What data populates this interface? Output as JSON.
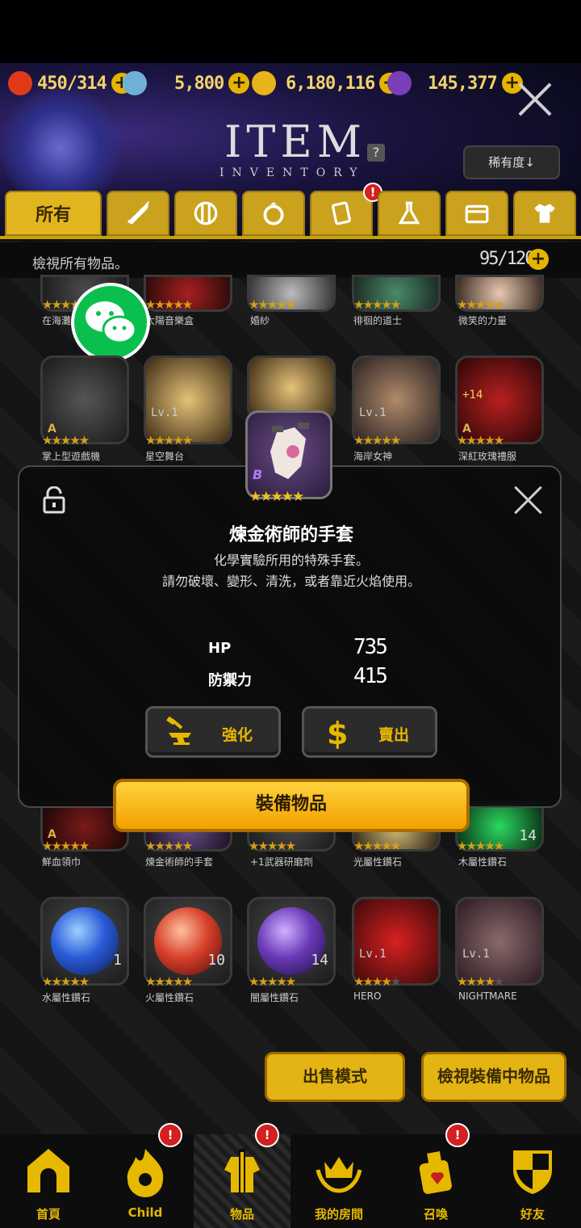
{
  "header": {
    "title": "ITEM",
    "subtitle": "INVENTORY",
    "sort_label": "稀有度↓",
    "resources": [
      {
        "name": "heart-icon",
        "value": "450/314",
        "color": "#e03a1a"
      },
      {
        "name": "crystal-icon",
        "value": "5,800",
        "color": "#6fb0d8"
      },
      {
        "name": "coin-icon",
        "value": "6,180,116",
        "color": "#e8b41a"
      },
      {
        "name": "gem-icon",
        "value": "145,377",
        "color": "#7a3fb8"
      }
    ],
    "help": "?"
  },
  "tabs": [
    {
      "label": "所有",
      "icon": "all"
    },
    {
      "label": "",
      "icon": "sword-icon"
    },
    {
      "label": "",
      "icon": "shield-icon"
    },
    {
      "label": "",
      "icon": "ring-icon"
    },
    {
      "label": "",
      "icon": "card-icon",
      "badge": "!"
    },
    {
      "label": "",
      "icon": "flask-icon"
    },
    {
      "label": "",
      "icon": "wallet-icon"
    },
    {
      "label": "",
      "icon": "shirt-icon"
    }
  ],
  "list": {
    "title": "檢視所有物品。",
    "count": "95/120"
  },
  "rows": {
    "row1": [
      {
        "name": "在海灘",
        "stars": 5
      },
      {
        "name": "太陽音樂盒",
        "stars": 5
      },
      {
        "name": "婚紗",
        "stars": 5
      },
      {
        "name": "徘徊的道士",
        "stars": 5
      },
      {
        "name": "微笑的力量",
        "stars": 5
      }
    ],
    "row2": [
      {
        "name": "掌上型遊戲機",
        "stars": 5,
        "rank": "A"
      },
      {
        "name": "星空舞台",
        "stars": 5,
        "lvl": "Lv.1"
      },
      {
        "name": "",
        "stars": 5
      },
      {
        "name": "海岸女神",
        "stars": 5,
        "lvl": "Lv.1"
      },
      {
        "name": "深紅玫瑰禮服",
        "stars": 5,
        "rank": "A",
        "plus": "+14"
      }
    ],
    "row5": [
      {
        "name": "鮮血領巾",
        "stars": 5,
        "rank": "A"
      },
      {
        "name": "煉金術師的手套",
        "stars": 5
      },
      {
        "name": "+1武器研磨劑",
        "stars": 5
      },
      {
        "name": "光屬性鑽石",
        "stars": 5
      },
      {
        "name": "木屬性鑽石",
        "stars": 5,
        "qty": "14"
      }
    ],
    "row6": [
      {
        "name": "水屬性鑽石",
        "stars": 5,
        "qty": "1",
        "color": "#2a5bd8"
      },
      {
        "name": "火屬性鑽石",
        "stars": 5,
        "qty": "10",
        "color": "#d8402a"
      },
      {
        "name": "闇屬性鑽石",
        "stars": 5,
        "qty": "14",
        "color": "#6a3ab8"
      },
      {
        "name": "HERO",
        "stars": 4,
        "lvl": "Lv.1"
      },
      {
        "name": "NIGHTMARE",
        "stars": 4,
        "lvl": "Lv.1"
      }
    ]
  },
  "detail": {
    "rank": "B",
    "stars": "★★★★★",
    "name": "煉金術師的手套",
    "desc_line1": "化學實驗所用的特殊手套。",
    "desc_line2": "請勿破壞、變形、清洗，或者靠近火焰使用。",
    "stats": [
      {
        "label": "HP",
        "value": "735"
      },
      {
        "label": "防禦力",
        "value": "415"
      }
    ],
    "enhance_label": "強化",
    "sell_label": "賣出",
    "equip_label": "裝備物品"
  },
  "bottom_buttons": {
    "sell_mode": "出售模式",
    "view_equipped": "檢視裝備中物品"
  },
  "nav": [
    {
      "label": "首頁",
      "icon": "home-icon"
    },
    {
      "label": "Child",
      "icon": "flame-icon",
      "badge": "!"
    },
    {
      "label": "物品",
      "icon": "armor-icon",
      "badge": "!",
      "active": true
    },
    {
      "label": "我的房間",
      "icon": "crown-icon"
    },
    {
      "label": "召喚",
      "icon": "summon-bottle-icon",
      "badge": "!"
    },
    {
      "label": "好友",
      "icon": "friends-shield-icon"
    }
  ]
}
